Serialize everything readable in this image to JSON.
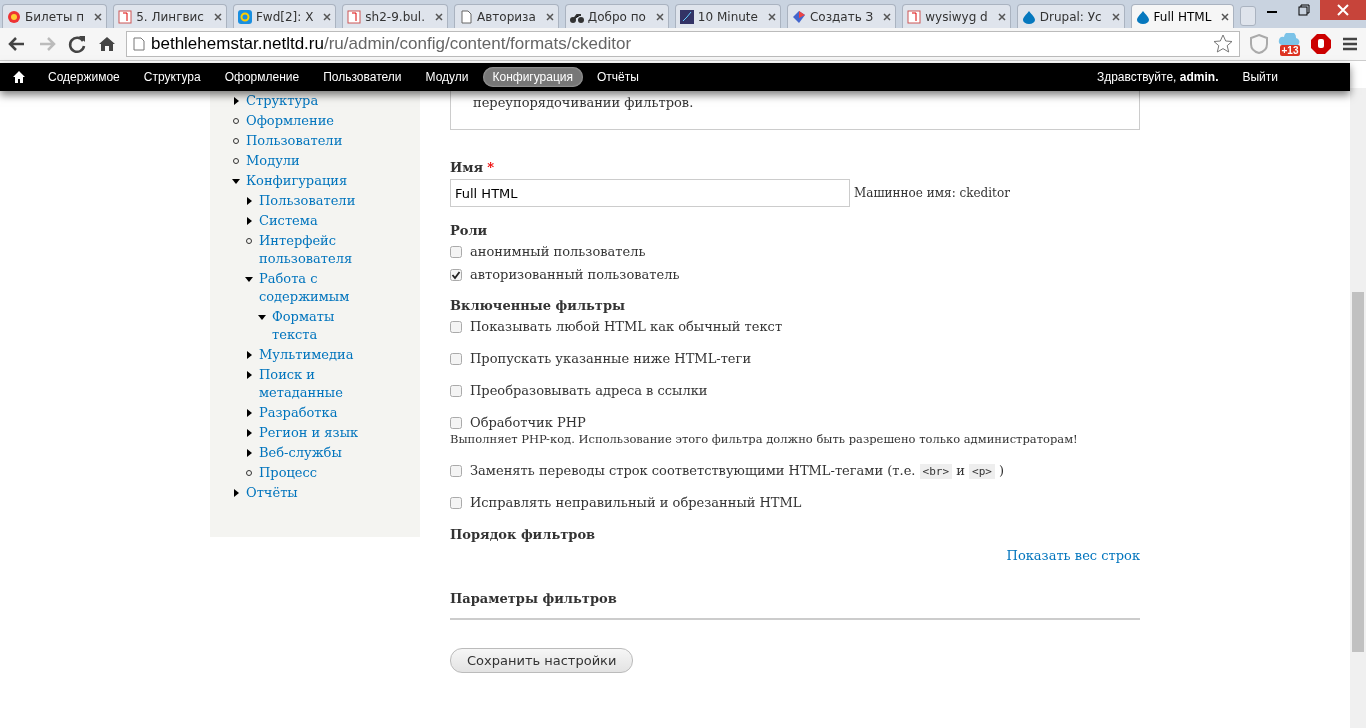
{
  "browser": {
    "tabs": [
      {
        "title": "Билеты п",
        "selected": false
      },
      {
        "title": "5. Лингвис",
        "selected": false
      },
      {
        "title": "Fwd[2]: Х",
        "selected": false
      },
      {
        "title": "sh2-9.bul.",
        "selected": false
      },
      {
        "title": "Авториза",
        "selected": false
      },
      {
        "title": "Добро по",
        "selected": false
      },
      {
        "title": "10 Minute",
        "selected": false
      },
      {
        "title": "Создать З",
        "selected": false
      },
      {
        "title": "wysiwyg d",
        "selected": false
      },
      {
        "title": "Drupal: Ус",
        "selected": false
      },
      {
        "title": "Full HTML",
        "selected": true
      }
    ],
    "url_host": "bethlehemstar.netltd.ru",
    "url_path": "/ru/admin/config/content/formats/ckeditor",
    "badge": "+13"
  },
  "toolbar": {
    "items": [
      {
        "label": "Содержимое",
        "selected": false
      },
      {
        "label": "Структура",
        "selected": false
      },
      {
        "label": "Оформление",
        "selected": false
      },
      {
        "label": "Пользователи",
        "selected": false
      },
      {
        "label": "Модули",
        "selected": false
      },
      {
        "label": "Конфигурация",
        "selected": true
      },
      {
        "label": "Отчёты",
        "selected": false
      }
    ],
    "greeting": "Здравствуйте,",
    "user": "admin.",
    "logout": "Выйти"
  },
  "sidebar": {
    "items": [
      {
        "label": "Структура",
        "kind": "branch",
        "expanded": false
      },
      {
        "label": "Оформление",
        "kind": "leaf"
      },
      {
        "label": "Пользователи",
        "kind": "leaf"
      },
      {
        "label": "Модули",
        "kind": "leaf"
      },
      {
        "label": "Конфигурация",
        "kind": "branch",
        "expanded": true,
        "children": [
          {
            "label": "Пользователи",
            "kind": "branch",
            "expanded": false
          },
          {
            "label": "Система",
            "kind": "branch",
            "expanded": false
          },
          {
            "label": "Интерфейс пользователя",
            "kind": "leaf"
          },
          {
            "label": "Работа с содержимым",
            "kind": "branch",
            "expanded": true,
            "children": [
              {
                "label": "Форматы текста",
                "kind": "branch",
                "expanded": true
              }
            ]
          },
          {
            "label": "Мультимедиа",
            "kind": "branch",
            "expanded": false
          },
          {
            "label": "Поиск и метаданные",
            "kind": "branch",
            "expanded": false
          },
          {
            "label": "Разработка",
            "kind": "branch",
            "expanded": false
          },
          {
            "label": "Регион и язык",
            "kind": "branch",
            "expanded": false
          },
          {
            "label": "Веб-службы",
            "kind": "branch",
            "expanded": false
          },
          {
            "label": "Процесс",
            "kind": "leaf"
          }
        ]
      },
      {
        "label": "Отчёты",
        "kind": "branch",
        "expanded": false
      }
    ]
  },
  "form": {
    "notice": "переупорядочивании фильтров.",
    "name_label": "Имя",
    "required_mark": "*",
    "name_value": "Full HTML",
    "machine_name": "Машинное имя: ckeditor",
    "roles_title": "Роли",
    "roles": [
      {
        "label": "анонимный пользователь",
        "checked": false
      },
      {
        "label": "авторизованный пользователь",
        "checked": true
      }
    ],
    "filters_title": "Включенные фильтры",
    "filters": [
      {
        "parts": [
          {
            "kind": "text",
            "text": "Показывать любой HTML как обычный текст"
          }
        ],
        "checked": false
      },
      {
        "parts": [
          {
            "kind": "text",
            "text": "Пропускать указанные ниже HTML-теги"
          }
        ],
        "checked": false
      },
      {
        "parts": [
          {
            "kind": "text",
            "text": "Преобразовывать адреса в ссылки"
          }
        ],
        "checked": false
      },
      {
        "parts": [
          {
            "kind": "text",
            "text": "Обработчик PHP"
          }
        ],
        "checked": false,
        "description": "Выполняет PHP-код. Использование этого фильтра должно быть разрешено только администраторам!"
      },
      {
        "parts": [
          {
            "kind": "text",
            "text": "Заменять переводы строк соответствующими HTML-тегами (т.е. "
          },
          {
            "kind": "code",
            "text": "<br>"
          },
          {
            "kind": "text",
            "text": " и "
          },
          {
            "kind": "code",
            "text": "<p>"
          },
          {
            "kind": "text",
            "text": " )"
          }
        ],
        "checked": false
      },
      {
        "parts": [
          {
            "kind": "text",
            "text": "Исправлять неправильный и обрезанный HTML"
          }
        ],
        "checked": false
      }
    ],
    "order_title": "Порядок фильтров",
    "weights_link": "Показать вес строк",
    "settings_title": "Параметры фильтров",
    "save": "Сохранить настройки"
  }
}
